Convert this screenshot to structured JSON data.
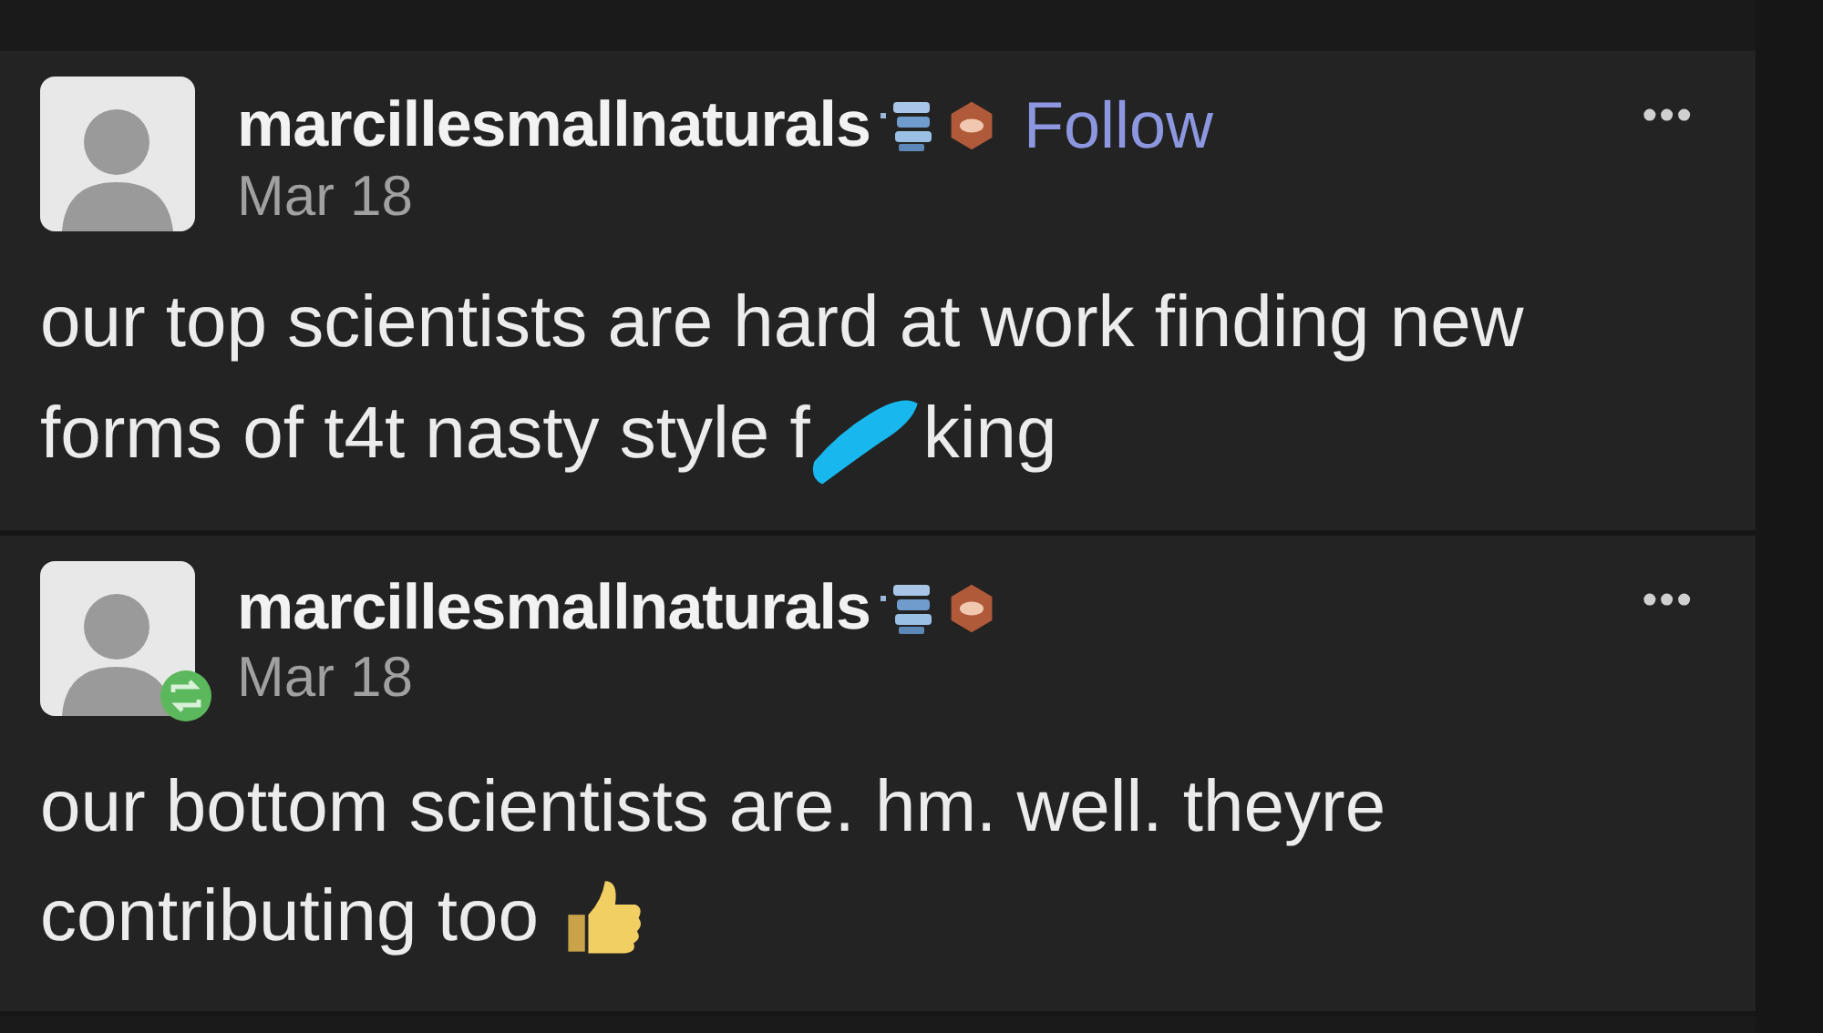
{
  "posts": [
    {
      "username": "marcillesmallnaturals",
      "follow": "Follow",
      "date": "Mar 18",
      "reblogged": false,
      "menu": "•••",
      "body_lines": [
        "our top scientists are hard at work finding new",
        "forms of t4t nasty style f"
      ],
      "censored": true,
      "body_after": "king",
      "thumbs_up": false
    },
    {
      "username": "marcillesmallnaturals",
      "date": "Mar 18",
      "reblogged": true,
      "menu": "•••",
      "body_lines": [
        "our bottom scientists are. hm. well. theyre",
        "contributing too"
      ],
      "censored": false,
      "thumbs_up": true
    }
  ]
}
